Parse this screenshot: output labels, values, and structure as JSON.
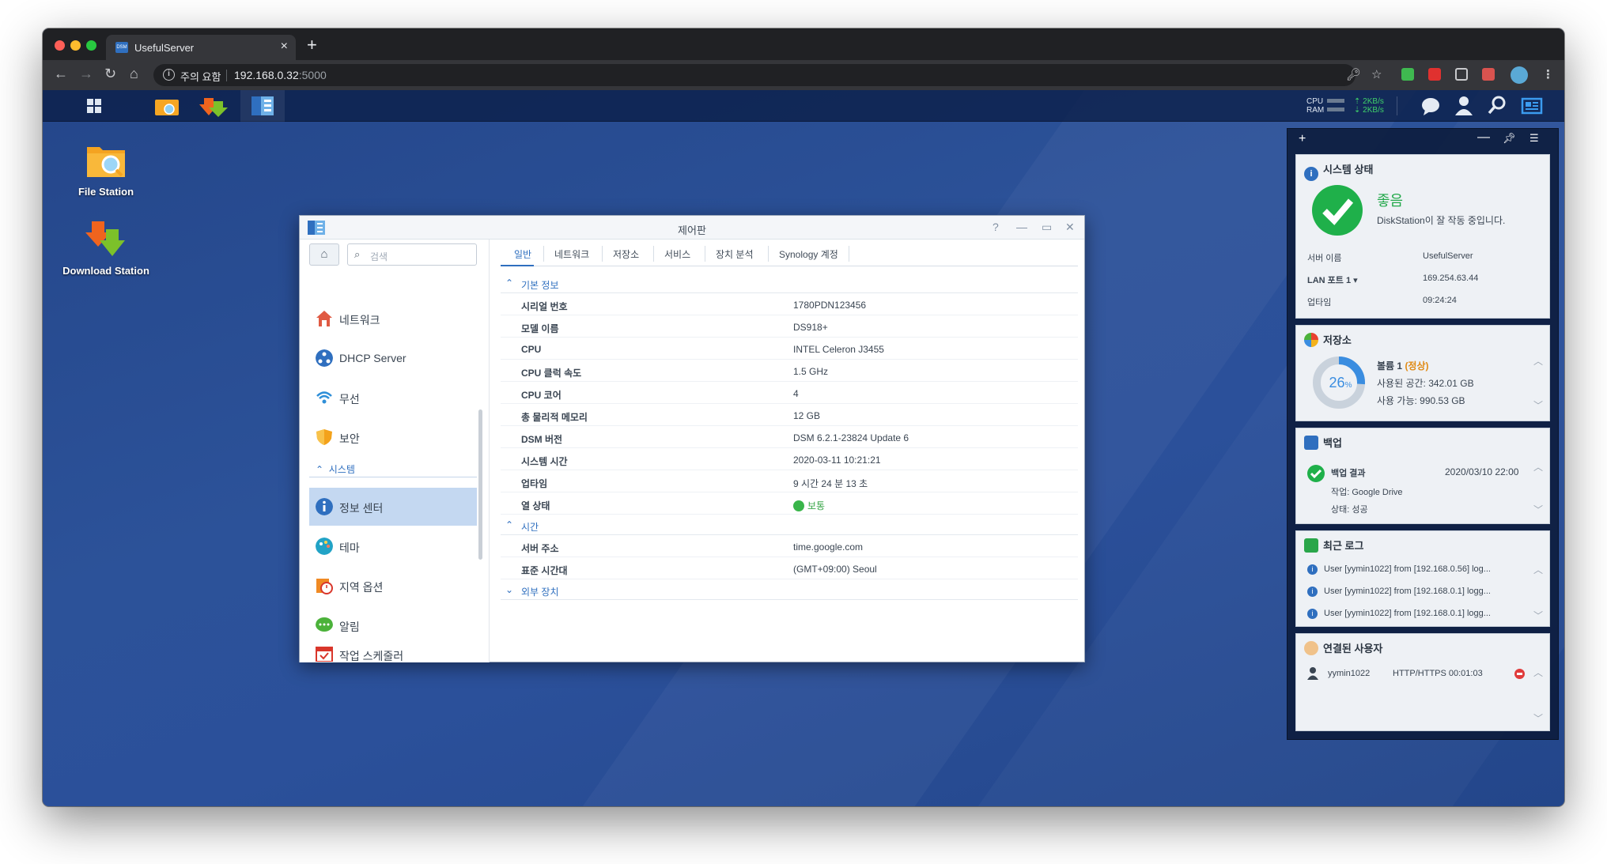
{
  "browser": {
    "tab_title": "UsefulServer",
    "tab_favicon": "DSM",
    "tab_close": "×",
    "new_tab": "+",
    "security_warning": "주의 요함",
    "url_host": "192.168.0.32",
    "url_port": ":5000",
    "nav": {
      "back": "←",
      "forward": "→",
      "reload": "↻",
      "home": "⌂"
    }
  },
  "taskbar": {
    "cpu_label": "CPU",
    "ram_label": "RAM",
    "upload": "2KB/s",
    "download": "2KB/s"
  },
  "desktop": {
    "icons": [
      {
        "label": "File Station"
      },
      {
        "label": "Download Station"
      }
    ]
  },
  "control_panel": {
    "title": "제어판",
    "search_placeholder": "검색",
    "sidebar": [
      {
        "label": "네트워크",
        "icon": "house-network-icon",
        "color": "#e05a43"
      },
      {
        "label": "DHCP Server",
        "icon": "dhcp-icon",
        "color": "#2f6fbf"
      },
      {
        "label": "무선",
        "icon": "wifi-icon",
        "color": "#2f8fd8"
      },
      {
        "label": "보안",
        "icon": "shield-icon",
        "color": "#f3a21b"
      }
    ],
    "sidebar_section": "시스템",
    "sidebar_system": [
      {
        "label": "정보 센터",
        "icon": "info-icon",
        "color": "#2f6fbf"
      },
      {
        "label": "테마",
        "icon": "palette-icon",
        "color": "#22a3c6"
      },
      {
        "label": "지역 옵션",
        "icon": "region-clock-icon",
        "color": "#f08a24"
      },
      {
        "label": "알림",
        "icon": "chat-notify-icon",
        "color": "#4bb23a"
      },
      {
        "label": "작업 스케줄러",
        "icon": "calendar-task-icon",
        "color": "#d9362b"
      }
    ],
    "tabs": [
      "일반",
      "네트워크",
      "저장소",
      "서비스",
      "장치 분석",
      "Synology 계정"
    ],
    "sections": {
      "basic": "기본 정보",
      "time": "시간",
      "external": "외부 장치"
    },
    "basic_rows": [
      {
        "k": "시리얼 번호",
        "v": "1780PDN123456"
      },
      {
        "k": "모델 이름",
        "v": "DS918+"
      },
      {
        "k": "CPU",
        "v": "INTEL Celeron J3455"
      },
      {
        "k": "CPU 클럭 속도",
        "v": "1.5 GHz"
      },
      {
        "k": "CPU 코어",
        "v": "4"
      },
      {
        "k": "총 물리적 메모리",
        "v": "12 GB"
      },
      {
        "k": "DSM 버전",
        "v": "DSM 6.2.1-23824 Update 6"
      },
      {
        "k": "시스템 시간",
        "v": "2020-03-11 10:21:21"
      },
      {
        "k": "업타임",
        "v": "9 시간 24 분 13 초"
      },
      {
        "k": "열 상태",
        "v": "보통"
      }
    ],
    "time_rows": [
      {
        "k": "서버 주소",
        "v": "time.google.com"
      },
      {
        "k": "표준 시간대",
        "v": "(GMT+09:00) Seoul"
      }
    ]
  },
  "widgets": {
    "system_status": {
      "title": "시스템 상태",
      "status": "좋음",
      "message": "DiskStation이 잘 작동 중입니다.",
      "server_name_label": "서버 이름",
      "server_name": "UsefulServer",
      "lan_label": "LAN 포트 1",
      "lan_ip": "169.254.63.44",
      "uptime_label": "업타임",
      "uptime": "09:24:24"
    },
    "storage": {
      "title": "저장소",
      "percent_number": "26",
      "percent_unit": "%",
      "used_fraction": 0.26,
      "volume": "볼륨 1",
      "volume_status": "(정상)",
      "used": "사용된 공간: 342.01 GB",
      "available": "사용 가능: 990.53 GB"
    },
    "backup": {
      "title": "백업",
      "result_label": "백업 결과",
      "result_date": "2020/03/10 22:00",
      "task": "작업: Google Drive",
      "state": "상태: 성공"
    },
    "logs": {
      "title": "최근 로그",
      "items": [
        "User [yymin1022] from [192.168.0.56] log...",
        "User [yymin1022] from [192.168.0.1] logg...",
        "User [yymin1022] from [192.168.0.1] logg..."
      ]
    },
    "users": {
      "title": "연결된 사용자",
      "user": "yymin1022",
      "protocol": "HTTP/HTTPS 00:01:03"
    }
  },
  "colors": {
    "accent": "#2f6fbf",
    "good": "#39b54a",
    "desktop": "#2c5299"
  }
}
